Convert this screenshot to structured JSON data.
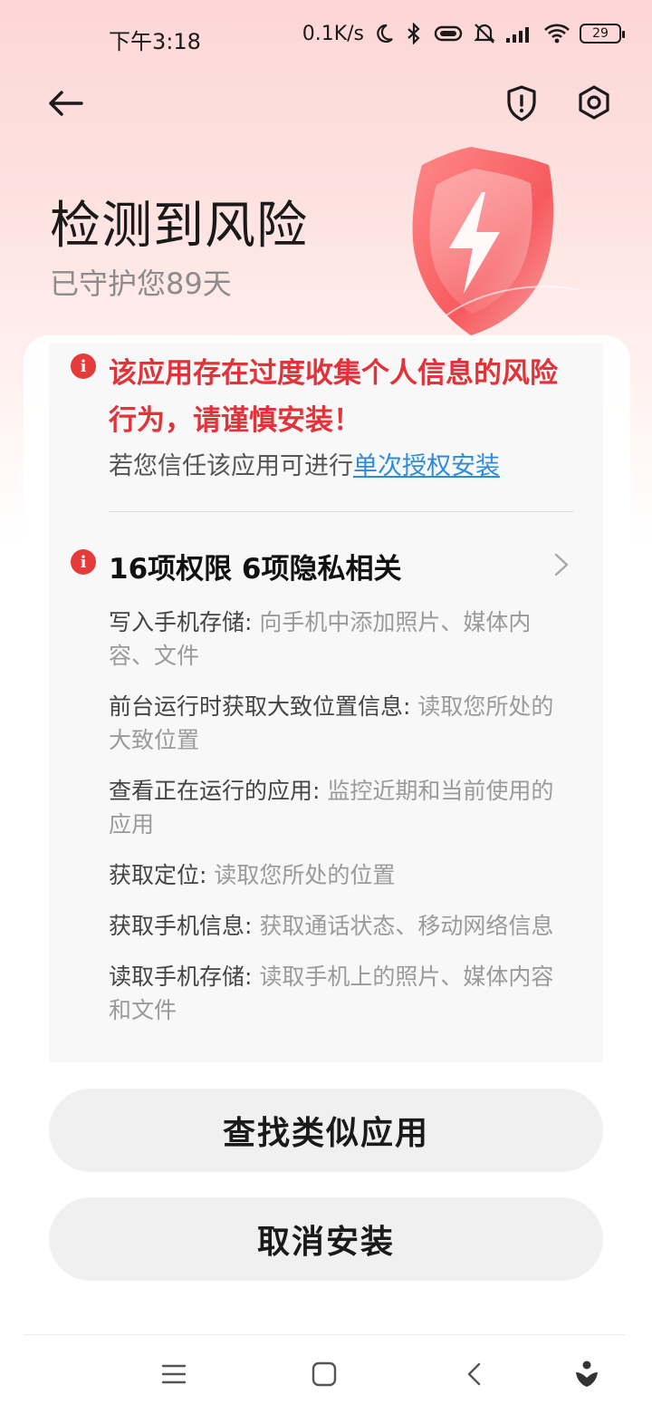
{
  "status_bar": {
    "time": "下午3:18",
    "net_speed": "0.1K/s",
    "battery": "29",
    "icons": [
      "moon-icon",
      "bluetooth-icon",
      "vibrate-icon",
      "mute-icon",
      "signal-icon",
      "wifi-icon",
      "battery-icon"
    ]
  },
  "header": {
    "title": "检测到风险",
    "subtitle": "已守护您89天"
  },
  "risk": {
    "warning": "该应用存在过度收集个人信息的风险行为，请谨慎安装！",
    "hint_prefix": "若您信任该应用可进行",
    "hint_link": "单次授权安装"
  },
  "permissions": {
    "summary": "16项权限 6项隐私相关",
    "items": [
      {
        "name": "写入手机存储:",
        "desc": "向手机中添加照片、媒体内容、文件"
      },
      {
        "name": "前台运行时获取大致位置信息:",
        "desc": "读取您所处的大致位置"
      },
      {
        "name": "查看正在运行的应用:",
        "desc": "监控近期和当前使用的应用"
      },
      {
        "name": "获取定位:",
        "desc": "读取您所处的位置"
      },
      {
        "name": "获取手机信息:",
        "desc": "获取通话状态、移动网络信息"
      },
      {
        "name": "读取手机存储:",
        "desc": "读取手机上的照片、媒体内容和文件"
      }
    ]
  },
  "buttons": {
    "find_similar": "查找类似应用",
    "cancel_install": "取消安装"
  },
  "colors": {
    "risk_red": "#e0333a",
    "link_blue": "#2e8bd9",
    "button_bg": "#f0f0f0"
  }
}
